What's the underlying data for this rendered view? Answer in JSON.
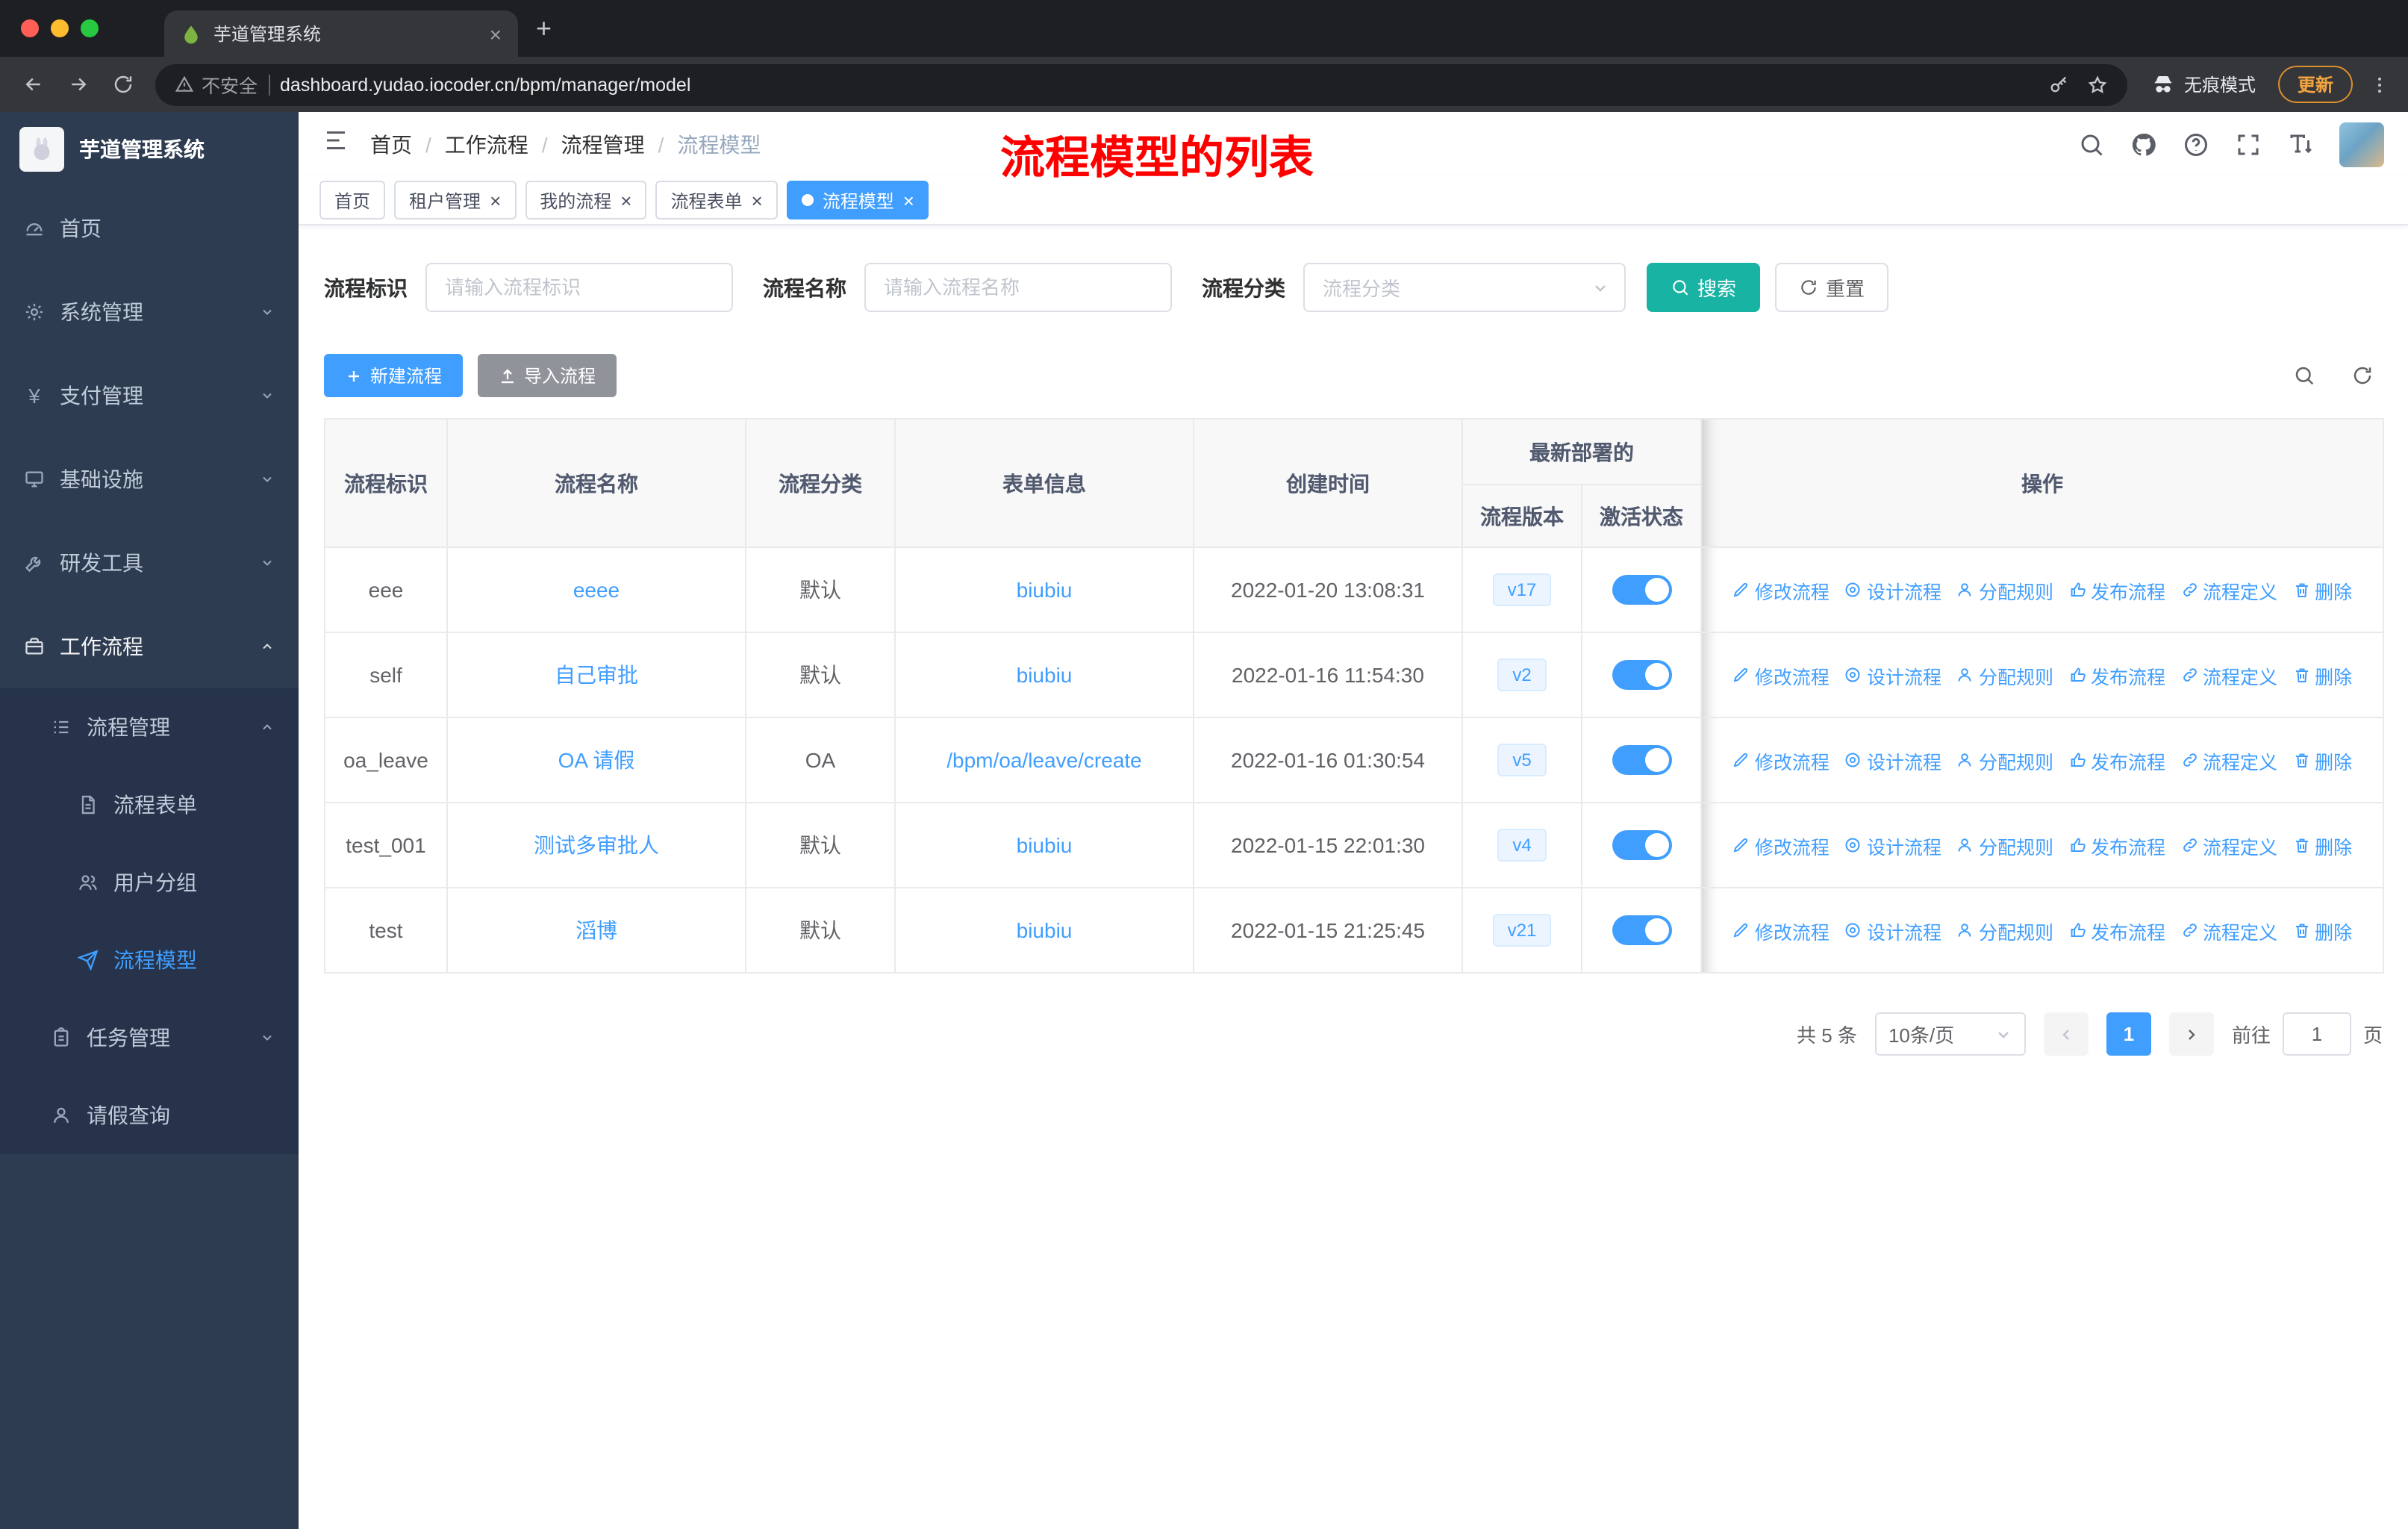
{
  "colors": {
    "primary": "#409eff",
    "search_button": "#18b3a3",
    "annotation": "#ff0000"
  },
  "browser": {
    "tab_title": "芋道管理系统",
    "security_label": "不安全",
    "url": "dashboard.yudao.iocoder.cn/bpm/manager/model",
    "incognito_label": "无痕模式",
    "update_label": "更新"
  },
  "sidebar": {
    "logo_text": "芋道管理系统",
    "items": [
      {
        "label": "首页",
        "icon": "dashboard-icon",
        "level": 1
      },
      {
        "label": "系统管理",
        "icon": "gear-icon",
        "level": 1,
        "arrow": "down"
      },
      {
        "label": "支付管理",
        "icon": "yen-icon",
        "level": 1,
        "arrow": "down"
      },
      {
        "label": "基础设施",
        "icon": "monitor-icon",
        "level": 1,
        "arrow": "down"
      },
      {
        "label": "研发工具",
        "icon": "toolbox-icon",
        "level": 1,
        "arrow": "down"
      },
      {
        "label": "工作流程",
        "icon": "briefcase-icon",
        "level": 1,
        "arrow": "up",
        "active": true
      },
      {
        "label": "流程管理",
        "icon": "list-icon",
        "level": 2,
        "arrow": "up",
        "dark": true
      },
      {
        "label": "流程表单",
        "icon": "document-icon",
        "level": 3,
        "dark": true
      },
      {
        "label": "用户分组",
        "icon": "users-icon",
        "level": 3,
        "dark": true
      },
      {
        "label": "流程模型",
        "icon": "paper-plane-icon",
        "level": 3,
        "dark": true,
        "selected": true
      },
      {
        "label": "任务管理",
        "icon": "clipboard-icon",
        "level": 2,
        "arrow": "down",
        "dark": true
      },
      {
        "label": "请假查询",
        "icon": "user-icon",
        "level": 2,
        "dark": true
      }
    ]
  },
  "header": {
    "breadcrumb": [
      "首页",
      "工作流程",
      "流程管理",
      "流程模型"
    ],
    "annotation": "流程模型的列表"
  },
  "tags": [
    {
      "label": "首页",
      "closable": false,
      "active": false
    },
    {
      "label": "租户管理",
      "closable": true,
      "active": false
    },
    {
      "label": "我的流程",
      "closable": true,
      "active": false
    },
    {
      "label": "流程表单",
      "closable": true,
      "active": false
    },
    {
      "label": "流程模型",
      "closable": true,
      "active": true
    }
  ],
  "filters": {
    "id_label": "流程标识",
    "id_placeholder": "请输入流程标识",
    "name_label": "流程名称",
    "name_placeholder": "请输入流程名称",
    "category_label": "流程分类",
    "category_placeholder": "流程分类",
    "search_label": "搜索",
    "reset_label": "重置"
  },
  "toolbar": {
    "create_label": "新建流程",
    "import_label": "导入流程"
  },
  "table": {
    "headers": {
      "id": "流程标识",
      "name": "流程名称",
      "category": "流程分类",
      "form": "表单信息",
      "created": "创建时间",
      "deployment_group": "最新部署的",
      "version": "流程版本",
      "status": "激活状态",
      "ops": "操作"
    },
    "rows": [
      {
        "id": "eee",
        "name": "eeee",
        "category": "默认",
        "form": "biubiu",
        "created": "2022-01-20 13:08:31",
        "version": "v17",
        "active": true
      },
      {
        "id": "self",
        "name": "自己审批",
        "category": "默认",
        "form": "biubiu",
        "created": "2022-01-16 11:54:30",
        "version": "v2",
        "active": true
      },
      {
        "id": "oa_leave",
        "name": "OA 请假",
        "category": "OA",
        "form": "/bpm/oa/leave/create",
        "created": "2022-01-16 01:30:54",
        "version": "v5",
        "active": true
      },
      {
        "id": "test_001",
        "name": "测试多审批人",
        "category": "默认",
        "form": "biubiu",
        "created": "2022-01-15 22:01:30",
        "version": "v4",
        "active": true
      },
      {
        "id": "test",
        "name": "滔博",
        "category": "默认",
        "form": "biubiu",
        "created": "2022-01-15 21:25:45",
        "version": "v21",
        "active": true
      }
    ],
    "actions": [
      {
        "label": "修改流程",
        "name": "edit-process-link",
        "icon": "edit-icon"
      },
      {
        "label": "设计流程",
        "name": "design-process-link",
        "icon": "target-icon"
      },
      {
        "label": "分配规则",
        "name": "assign-rule-link",
        "icon": "user-icon"
      },
      {
        "label": "发布流程",
        "name": "publish-process-link",
        "icon": "publish-icon"
      },
      {
        "label": "流程定义",
        "name": "process-definition-link",
        "icon": "link-icon"
      },
      {
        "label": "删除",
        "name": "delete-link",
        "icon": "trash-icon"
      }
    ]
  },
  "pagination": {
    "total": "共 5 条",
    "page_size": "10条/页",
    "current_page": "1",
    "goto_label": "前往",
    "goto_value": "1",
    "page_unit": "页"
  }
}
